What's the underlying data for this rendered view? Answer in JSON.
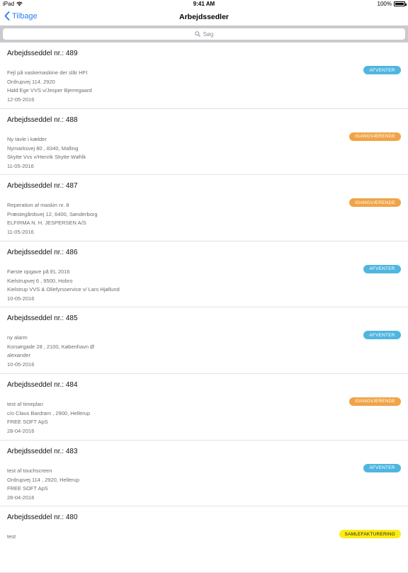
{
  "status_bar": {
    "carrier": "iPad",
    "time": "9:41 AM",
    "battery": "100%"
  },
  "nav": {
    "back_label": "Tilbage",
    "title": "Arbejdssedler"
  },
  "search": {
    "placeholder": "Søg"
  },
  "colors": {
    "accent": "#2a7cf6",
    "afventer": "#4fb6e0",
    "igangvaerende": "#f0a446",
    "samlefakturering": "#fcec14"
  },
  "items": [
    {
      "title": "Arbejdsseddel nr.: 489",
      "lines": [
        "Fejl på vaskemaskine der slår HFI",
        "Ordrupvej 114, 2920",
        "Hald Ege VVS v/Jesper Bjerregaard",
        "12-05-2016"
      ],
      "status": "AFVENTER",
      "status_color": "blue"
    },
    {
      "title": "Arbejdsseddel nr.: 488",
      "lines": [
        "Ny tavle i kælder",
        "Nymarksvej 80 , 8340, Malling",
        "Skytte Vvs v/Henrik Skytte Wøhlk",
        "11-05-2016"
      ],
      "status": "IGANGVÆRENDE",
      "status_color": "orange"
    },
    {
      "title": "Arbejdsseddel nr.: 487",
      "lines": [
        "Reperation af maskin nr. 8",
        "Præstegårdsvej 12, 6400, Sønderborg",
        "ELFIRMA N. H. JESPERSEN A/S",
        "11-05-2016"
      ],
      "status": "IGANGVÆRENDE",
      "status_color": "orange"
    },
    {
      "title": "Arbejdsseddel nr.: 486",
      "lines": [
        "Første opgave på EL 2016",
        "Kielstrupvej 6 , 9500, Hobro",
        "Kielstrup VVS & Oliefyrsservice v/ Lars Hjøllund",
        "10-05-2016"
      ],
      "status": "AFVENTER",
      "status_color": "blue"
    },
    {
      "title": "Arbejdsseddel nr.: 485",
      "lines": [
        "ny alarm",
        "Korsørgade 28 , 2100, København Ø",
        "alexander",
        "10-05-2016"
      ],
      "status": "AFVENTER",
      "status_color": "blue"
    },
    {
      "title": "Arbejdsseddel nr.: 484",
      "lines": [
        "test af timeplan",
        "c/o Claus Bardram , 2900, Hellerup",
        "FREE SOFT ApS",
        "28-04-2016"
      ],
      "status": "IGANGVÆRENDE",
      "status_color": "orange"
    },
    {
      "title": "Arbejdsseddel nr.: 483",
      "lines": [
        "test af touchscreen",
        "Ordrupvej 114 , 2920, Hellerup",
        "FREE SOFT ApS",
        "28-04-2016"
      ],
      "status": "AFVENTER",
      "status_color": "blue"
    },
    {
      "title": "Arbejdsseddel nr.: 480",
      "lines": [
        "test",
        "",
        "",
        ""
      ],
      "status": "SAMLEFAKTURERING",
      "status_color": "yellow"
    }
  ]
}
